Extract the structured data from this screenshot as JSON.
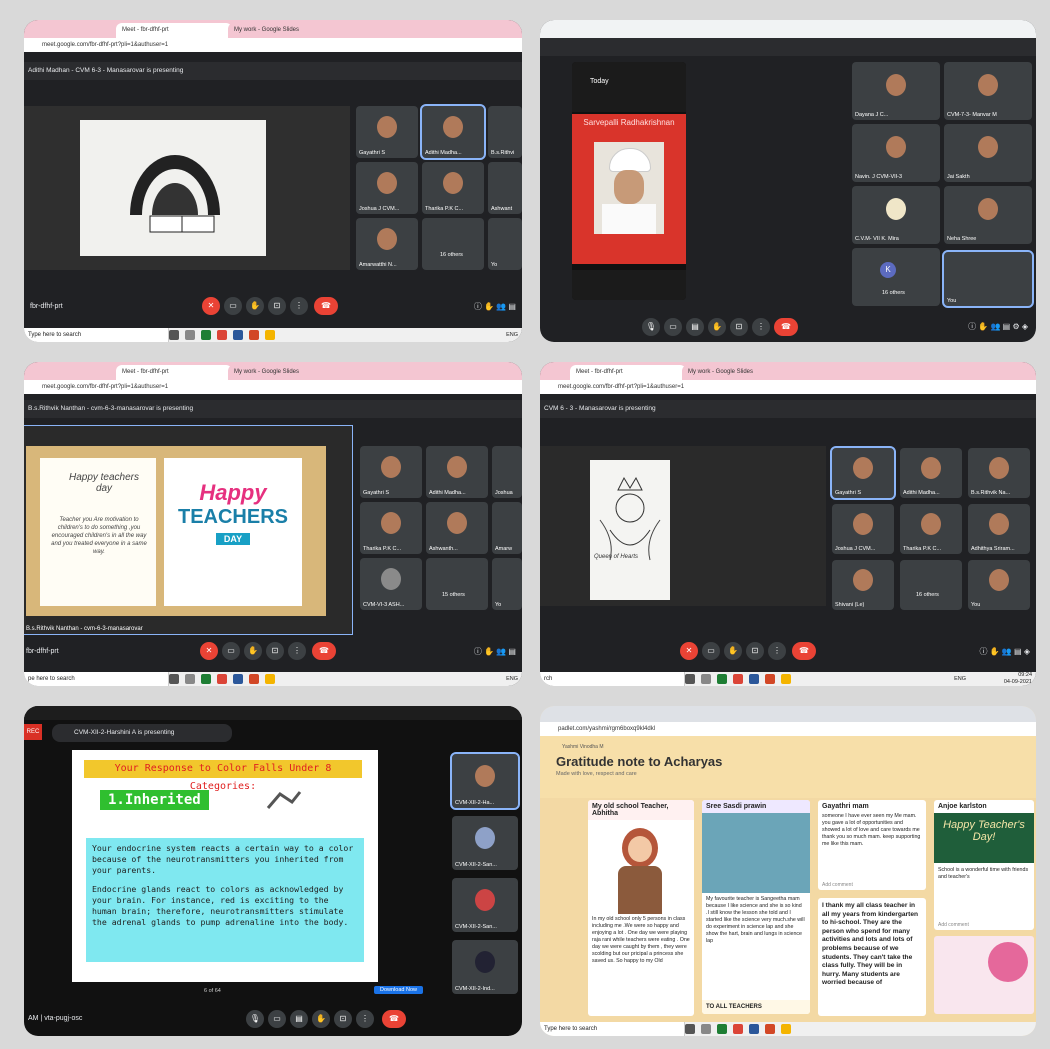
{
  "p1": {
    "tabs": [
      "Meet - fbr-dfhf-prt",
      "My work - Google Slides"
    ],
    "url": "meet.google.com/fbr-dfhf-prt?pli=1&authuser=1",
    "presenting": "Adithi Madhan - CVM 6-3 - Manasarovar is presenting",
    "tiles": [
      "Gayathri S",
      "Adithi Madha...",
      "B.s.Rithvi",
      "Joshua J CVM...",
      "Tharika P.K C...",
      "Ashwant",
      "Amarwatthi N...",
      "16 others",
      "Yo"
    ],
    "code": "fbr-dfhf-prt",
    "taskbar_search": "Type here to search",
    "tray": "ENG"
  },
  "p2": {
    "phone_header": "Today",
    "poster": "Sarvepalli Radhakrishnan",
    "tiles": [
      "Dayana J C...",
      "CVM-7-3- Manvar M",
      "Navin. J CVM-VII-3",
      "Jai Sakth",
      "C.V.M- VII K. Mira",
      "Neha Shree",
      "16 others",
      "You"
    ],
    "avatar_letter": "K"
  },
  "p3": {
    "tabs": [
      "Meet - fbr-dfhf-prt",
      "My work - Google Slides"
    ],
    "url": "meet.google.com/fbr-dfhf-prt?pli=1&authuser=1",
    "presenting": "B.s.Rithvik Nanthan - cvm-6-3-manasarovar is presenting",
    "card_title": "Happy teachers day",
    "card_text": "Teacher you Are motivation to children's to do something ,you encouraged children's in all the way and you treated everyone in a same way.",
    "art_happy": "Happy",
    "art_teachers": "TEACHERS",
    "art_day": "DAY",
    "slide_caption": "B.s.Rithvik Nanthan - cvm-6-3-manasarovar",
    "tiles": [
      "Gayathri S",
      "Adithi Madha...",
      "Joshua",
      "Tharika P.K C...",
      "Ashwanth...",
      "Amarw",
      "CVM-VI-3 ASH...",
      "15 others",
      "Yo"
    ],
    "code": "fbr-dfhf-prt",
    "taskbar_search": "pe here to search",
    "tray": "ENG"
  },
  "p4": {
    "tabs": [
      "Meet - fbr-dfhf-prt",
      "My work - Google Slides"
    ],
    "url": "meet.google.com/fbr-dfhf-prt?pli=1&authuser=1",
    "presenting": "CVM 6 - 3 - Manasarovar is presenting",
    "drawing_label": "Queen of Hearts",
    "tiles": [
      "Gayathri S",
      "Adithi Madha...",
      "B.s.Rithvik Na...",
      "Joshua J CVM...",
      "Tharika P.K C...",
      "Adhithya Sriram...",
      "Shivani (Le)",
      "16 others",
      "You"
    ],
    "taskbar_search": "rch",
    "time": "09:24",
    "date": "04-09-2021",
    "tray": "ENG"
  },
  "p5": {
    "presenting": "CVM-XII-2-Harshini A is presenting",
    "rec": "REC",
    "slide_heading": "Your Response to Color Falls Under 8 Categories:",
    "slide_sub": "1.Inherited",
    "para1": "Your endocrine system reacts a certain way to a color because of the neurotransmitters you inherited from your parents.",
    "para2": "Endocrine glands react to colors as acknowledged by your brain. For instance, red is exciting to the human brain; therefore, neurotransmitters stimulate the adrenal glands to pump adrenaline into the body.",
    "page": "6 of 64",
    "download": "Download Now",
    "tiles": [
      "CVM-XII-2-Ha...",
      "CVM-XII-2-San...",
      "CVM-XII-2-San...",
      "CVM-XII-2-Ind..."
    ],
    "code": "AM | vta-pugj-osc"
  },
  "p6": {
    "url": "padlet.com/yashmi/rgm6boxq9kl4dkl",
    "author": "Yashmi Vinodha M",
    "title": "Gratitude note to Acharyas",
    "subtitle": "Made with love, respect and care",
    "cards": [
      {
        "title": "My old school Teacher, Abhitha",
        "text": "In my old school only 5 persons in class including me .We were so happy and enjoying a lot . One day we were playing raja rani while teachers were eating . One day we were caught by them , they were scolding but our pricipal a princess she saved us. So happy to my Old"
      },
      {
        "title": "Sree Sasdi prawin",
        "text": "My favourite teacher is Sangeetha mam because I like science and she is so kind .I still know the lesson she told and I started like the science very much.she will do experiment in science lap and she show the hart, brain and lungs in science lap",
        "footer": "TO ALL TEACHERS"
      },
      {
        "title": "Gayathri mam",
        "text": "someone I have ever seen my Me mam. you gave a lot of opportunities and showed a lot of love and care towards me thank you so much mam. keep supporting me like this mam.",
        "text2": "I thank my all class teacher in all my years from kindergarten to hi-school. They are the person who spend for many activities and lots and lots of problems because of we students. They can't take the class fully. They will be in hurry. Many students are worried because of"
      },
      {
        "title": "Anjoe karlston",
        "text": "School is a wonderful time with friends and teacher's",
        "art": "Happy Teacher's Day!"
      }
    ],
    "add_comment": "Add comment",
    "taskbar_search": "Type here to search"
  }
}
